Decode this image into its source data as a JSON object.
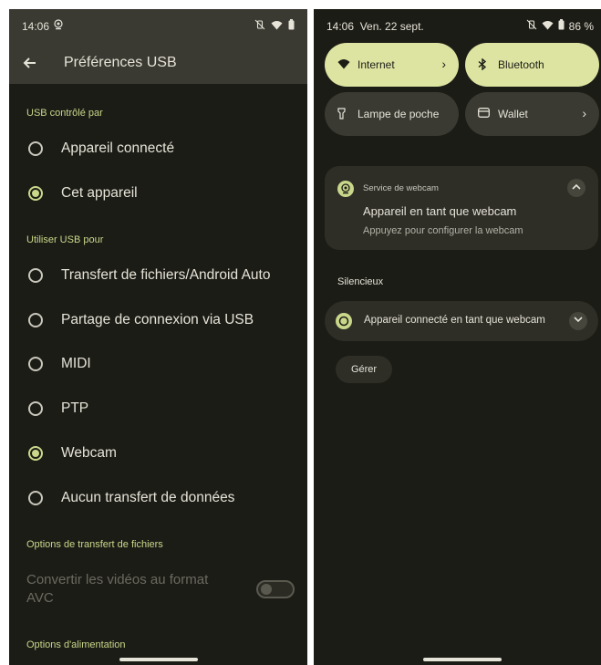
{
  "left": {
    "status": {
      "time": "14:06"
    },
    "appbar": {
      "title": "Préférences USB"
    },
    "usb_controlled_by": {
      "header": "USB contrôlé par",
      "options": [
        {
          "label": "Appareil connecté",
          "selected": false
        },
        {
          "label": "Cet appareil",
          "selected": true
        }
      ]
    },
    "use_usb_for": {
      "header": "Utiliser USB pour",
      "options": [
        {
          "label": "Transfert de fichiers/Android Auto",
          "selected": false
        },
        {
          "label": "Partage de connexion via USB",
          "selected": false
        },
        {
          "label": "MIDI",
          "selected": false
        },
        {
          "label": "PTP",
          "selected": false
        },
        {
          "label": "Webcam",
          "selected": true
        },
        {
          "label": "Aucun transfert de données",
          "selected": false
        }
      ]
    },
    "file_transfer_options": {
      "header": "Options de transfert de fichiers",
      "convert_label": "Convertir les vidéos au format AVC",
      "convert_enabled": false
    },
    "power_options": {
      "header": "Options d'alimentation"
    }
  },
  "right": {
    "status": {
      "time": "14:06",
      "date": "Ven. 22 sept.",
      "battery": "86 %"
    },
    "tiles": [
      {
        "label": "Internet",
        "active": true,
        "chevron": "›"
      },
      {
        "label": "Bluetooth",
        "active": true
      },
      {
        "label": "Lampe de poche",
        "active": false
      },
      {
        "label": "Wallet",
        "active": false,
        "chevron": "›"
      }
    ],
    "notification": {
      "app_name": "Service de webcam",
      "title": "Appareil en tant que webcam",
      "text": "Appuyez pour configurer la webcam"
    },
    "silent": {
      "header": "Silencieux",
      "title": "Appareil connecté en tant que webcam"
    },
    "manage_label": "Gérer"
  },
  "colors": {
    "accent": "#c9d78a",
    "tile_active": "#dde4a1",
    "background": "#1c1c16",
    "surface": "#3a3a32"
  }
}
